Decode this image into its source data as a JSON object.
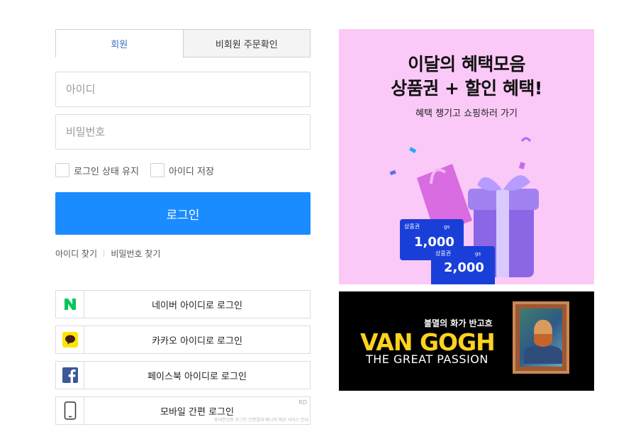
{
  "tabs": {
    "member": "회원",
    "guest": "비회원 주문확인"
  },
  "inputs": {
    "id_placeholder": "아이디",
    "pw_placeholder": "비밀번호"
  },
  "checkboxes": {
    "keep_login": "로그인 상태 유지",
    "save_id": "아이디 저장"
  },
  "login_button": "로그인",
  "find": {
    "find_id": "아이디 찾기",
    "find_pw": "비밀번호 찾기"
  },
  "social": {
    "naver": "네이버 아이디로 로그인",
    "kakao": "카카오 아이디로 로그인",
    "facebook": "페이스북 아이디로 로그인",
    "mobile": "모바일 간편 로그인",
    "rd": "RD",
    "fine_print": "휴대폰인증 로그인 간편결제 매니저 제공 서비스 안내"
  },
  "ad_benefit": {
    "line1": "이달의 혜택모음",
    "line2": "상품권 + 할인 혜택!",
    "sub": "혜택 챙기고 쇼핑하러 가기",
    "voucher1_label": "상품권",
    "voucher1_value": "1,000",
    "voucher2_label": "상품권",
    "voucher2_value": "2,000",
    "brand": "gs",
    "colors": {
      "bg": "#fbc9f7",
      "voucher": "#1a3fd8",
      "gift": "#8b67e6",
      "bag": "#d86ce0"
    }
  },
  "ad_vangogh": {
    "korean": "불멸의 화가 반고흐",
    "title": "VAN GOGH",
    "subtitle": "THE GREAT PASSION",
    "colors": {
      "bg": "#000000",
      "title": "#ffd21f"
    }
  },
  "icons": [
    "naver-icon",
    "kakao-icon",
    "facebook-icon",
    "mobile-phone-icon"
  ],
  "colors": {
    "primary": "#1a8cff",
    "tab_active_text": "#3b72c7",
    "naver": "#03c75a",
    "kakao": "#fee500",
    "facebook": "#3b5998"
  }
}
